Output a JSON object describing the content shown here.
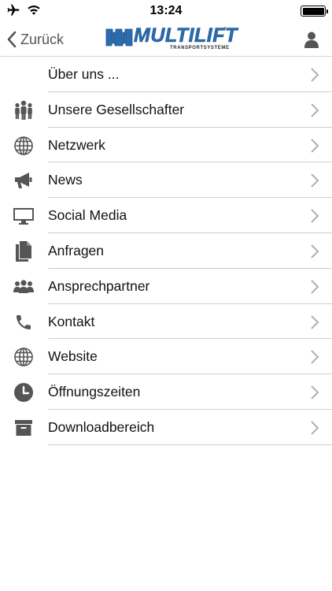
{
  "status_bar": {
    "time": "13:24",
    "icons": [
      "airplane-icon",
      "wifi-icon",
      "battery-icon"
    ]
  },
  "nav": {
    "back_label": "Zurück",
    "logo_text": "MULTILIFT",
    "logo_subtitle": "TRANSPORTSYSTEME",
    "logo_registered": "®",
    "profile_icon": "person-icon"
  },
  "menu": {
    "items": [
      {
        "label": "Über uns ...",
        "icon": "none"
      },
      {
        "label": "Unsere Gesellschafter",
        "icon": "people-group-icon"
      },
      {
        "label": "Netzwerk",
        "icon": "globe-icon"
      },
      {
        "label": "News",
        "icon": "megaphone-icon"
      },
      {
        "label": "Social Media",
        "icon": "monitor-icon"
      },
      {
        "label": "Anfragen",
        "icon": "documents-icon"
      },
      {
        "label": "Ansprechpartner",
        "icon": "contacts-icon"
      },
      {
        "label": "Kontakt",
        "icon": "phone-icon"
      },
      {
        "label": "Website",
        "icon": "globe-icon"
      },
      {
        "label": "Öffnungszeiten",
        "icon": "clock-icon"
      },
      {
        "label": "Downloadbereich",
        "icon": "archive-box-icon"
      }
    ]
  },
  "colors": {
    "icon": "#555555",
    "logo_blue": "#2a6cb3",
    "divider": "#cfcfcf",
    "chevron": "#b0b0b0"
  }
}
